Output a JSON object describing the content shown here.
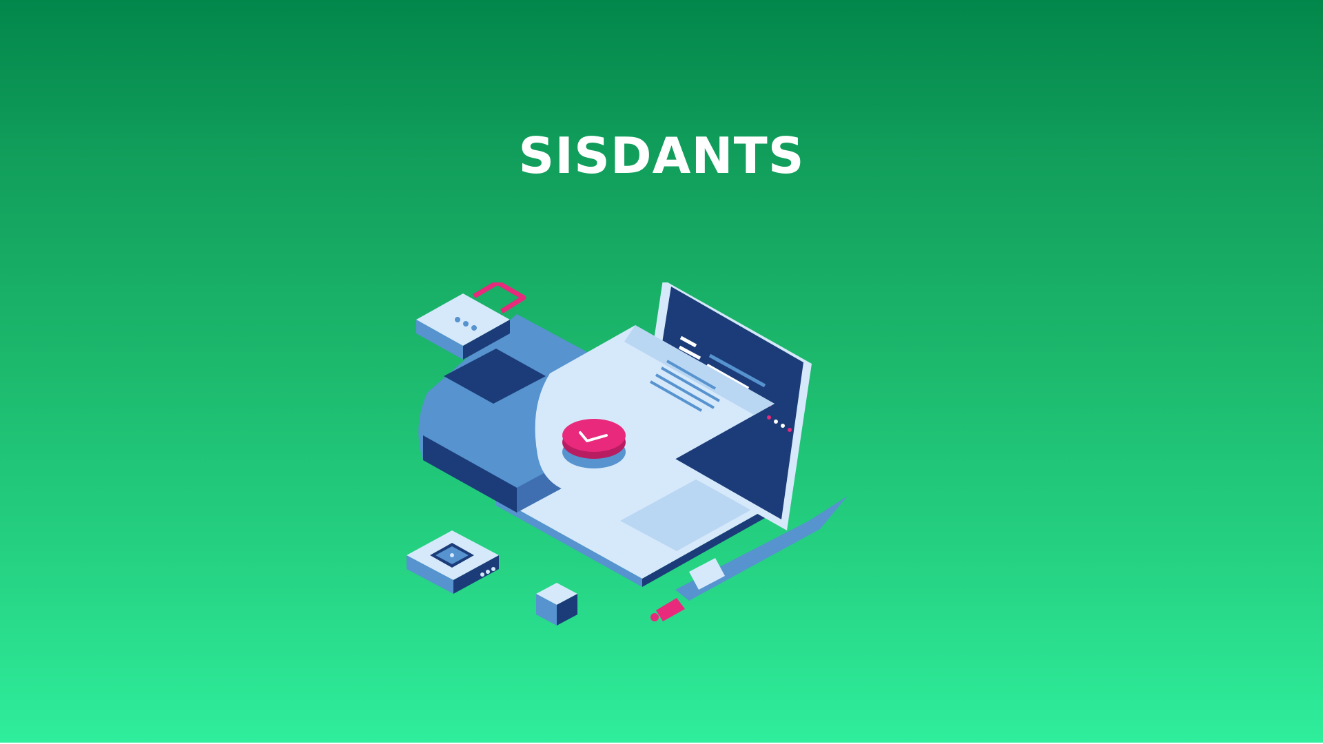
{
  "banner": {
    "title": "SISDANTS",
    "background_top": "#02874b",
    "background_bottom": "#2fee9c"
  },
  "illustration": {
    "subject": "document-approval-illustration",
    "colors": {
      "dark_blue": "#1b3c78",
      "mid_blue": "#5693cf",
      "light_blue": "#d6e9fb",
      "accent_pink": "#e8297c"
    }
  }
}
